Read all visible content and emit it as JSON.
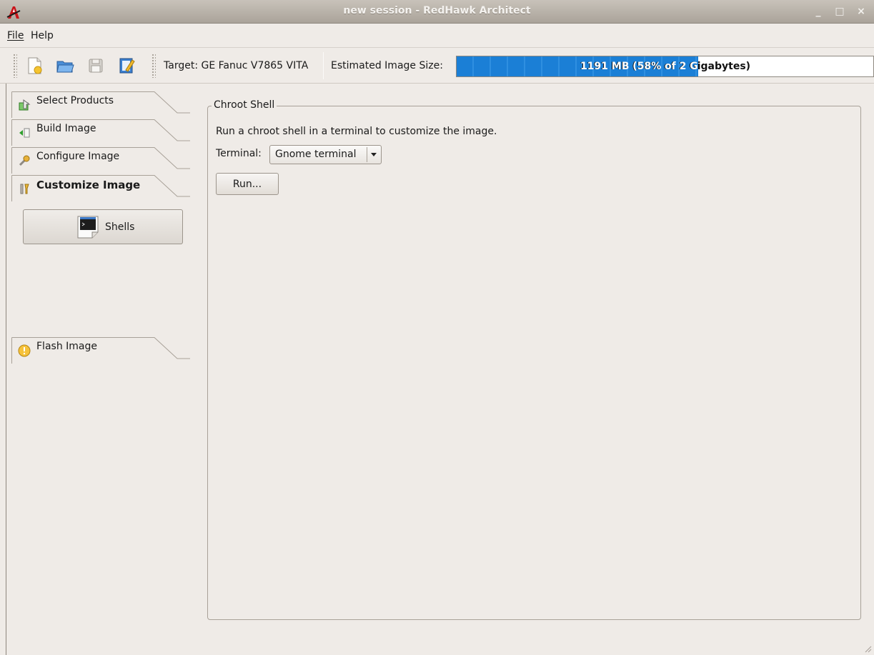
{
  "window": {
    "title": "new session - RedHawk Architect",
    "buttons": {
      "minimize": "_",
      "maximize": "□",
      "close": "×"
    }
  },
  "menubar": {
    "items": [
      {
        "label": "File"
      },
      {
        "label": "Help"
      }
    ]
  },
  "toolbar": {
    "buttons": [
      "new-session-icon",
      "open-session-icon",
      "save-session-icon",
      "edit-session-icon"
    ],
    "target_label": "Target: GE Fanuc V7865 VITA",
    "size_label": "Estimated Image Size:",
    "progress": {
      "text": "1191 MB (58% of 2 Gigabytes)",
      "fraction": 0.58,
      "color": "#1b7fd6"
    }
  },
  "sidebar": {
    "tabs": [
      {
        "label": "Select Products",
        "icon": "select-products-icon"
      },
      {
        "label": "Build Image",
        "icon": "build-image-icon"
      },
      {
        "label": "Configure Image",
        "icon": "wrench-icon"
      },
      {
        "label": "Customize Image",
        "icon": "customize-tools-icon",
        "active": true
      },
      {
        "label": "Flash Image",
        "icon": "flash-icon"
      }
    ],
    "shells_button": {
      "label": "Shells",
      "icon": "terminal-icon"
    }
  },
  "main": {
    "group_title": "Chroot Shell",
    "description": "Run a chroot shell in a terminal to customize the image.",
    "terminal_label": "Terminal:",
    "terminal_value": "Gnome terminal",
    "run_label": "Run..."
  }
}
